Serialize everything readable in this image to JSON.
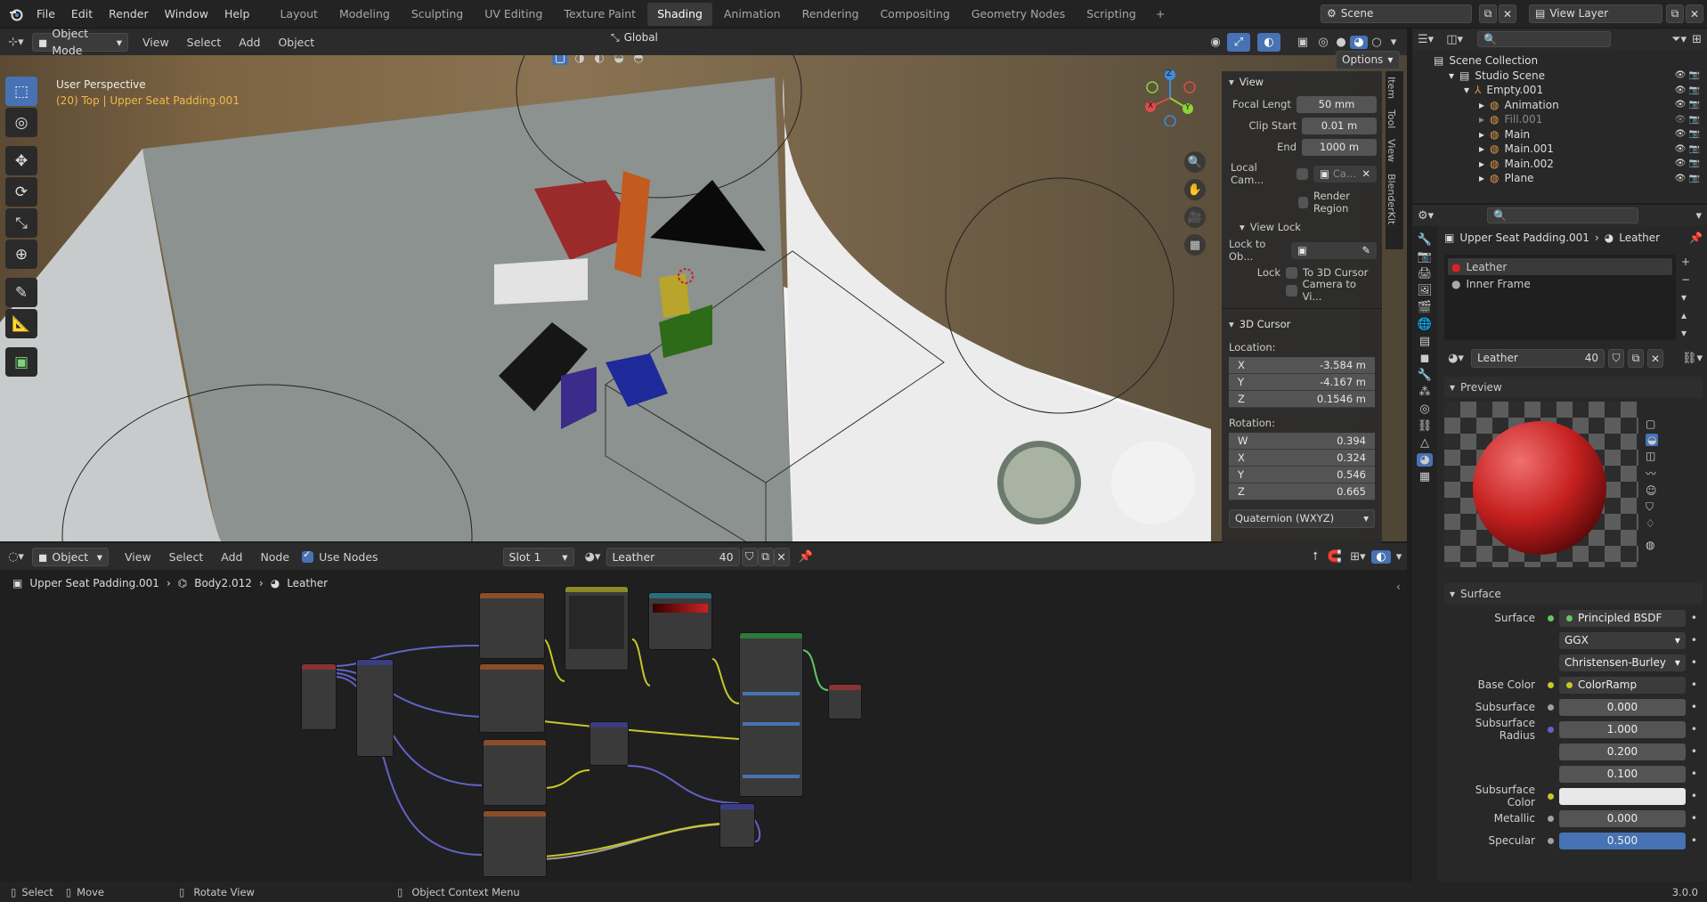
{
  "topbar": {
    "menus": [
      "File",
      "Edit",
      "Render",
      "Window",
      "Help"
    ],
    "workspaces": [
      "Layout",
      "Modeling",
      "Sculpting",
      "UV Editing",
      "Texture Paint",
      "Shading",
      "Animation",
      "Rendering",
      "Compositing",
      "Geometry Nodes",
      "Scripting"
    ],
    "active_workspace": "Shading",
    "add_tab": "+",
    "scene": "Scene",
    "view_layer": "View Layer"
  },
  "viewport": {
    "mode": "Object Mode",
    "menus": [
      "View",
      "Select",
      "Add",
      "Object"
    ],
    "orientation": "Global",
    "options": "Options",
    "overlay_title": "User Perspective",
    "overlay_sub": "(20) Top | Upper Seat Padding.001",
    "gizmo": {
      "z": "Z",
      "x": "X",
      "y": "Y"
    }
  },
  "npanel": {
    "tabs": [
      "Item",
      "Tool",
      "View",
      "BlenderKit"
    ],
    "view": {
      "header": "View",
      "focal_label": "Focal Lengt",
      "focal": "50 mm",
      "clip_start_label": "Clip Start",
      "clip_start": "0.01 m",
      "end_label": "End",
      "end": "1000 m",
      "local_cam_label": "Local Cam...",
      "local_cam_value": "Ca...",
      "render_region": "Render Region",
      "view_lock": "View Lock",
      "lock_to_obj_label": "Lock to Ob...",
      "lock_label": "Lock",
      "lock_cursor": "To 3D Cursor",
      "lock_camera": "Camera to Vi..."
    },
    "cursor": {
      "header": "3D Cursor",
      "location": "Location:",
      "loc": [
        {
          "k": "X",
          "v": "-3.584 m"
        },
        {
          "k": "Y",
          "v": "-4.167 m"
        },
        {
          "k": "Z",
          "v": "0.1546 m"
        }
      ],
      "rotation": "Rotation:",
      "rot": [
        {
          "k": "W",
          "v": "0.394"
        },
        {
          "k": "X",
          "v": "0.324"
        },
        {
          "k": "Y",
          "v": "0.546"
        },
        {
          "k": "Z",
          "v": "0.665"
        }
      ],
      "mode": "Quaternion (WXYZ)"
    }
  },
  "outliner": {
    "root": "Scene Collection",
    "items": [
      {
        "name": "Studio Scene",
        "indent": 1
      },
      {
        "name": "Empty.001",
        "indent": 2
      },
      {
        "name": "Animation",
        "indent": 3
      },
      {
        "name": "Fill.001",
        "indent": 3,
        "dim": true
      },
      {
        "name": "Main",
        "indent": 3
      },
      {
        "name": "Main.001",
        "indent": 3
      },
      {
        "name": "Main.002",
        "indent": 3
      },
      {
        "name": "Plane",
        "indent": 3
      }
    ]
  },
  "properties": {
    "breadcrumb_obj": "Upper Seat Padding.001",
    "breadcrumb_mat": "Leather",
    "slots": [
      "Leather",
      "Inner Frame"
    ],
    "material": "Leather",
    "users": "40",
    "preview": "Preview",
    "surface_header": "Surface",
    "rows": [
      {
        "l": "Surface",
        "v": "Principled BSDF",
        "kind": "link",
        "dot": "#63c763"
      },
      {
        "l": "",
        "v": "GGX",
        "kind": "dd"
      },
      {
        "l": "",
        "v": "Christensen-Burley",
        "kind": "dd"
      },
      {
        "l": "Base Color",
        "v": "ColorRamp",
        "kind": "link",
        "dot": "#c7c729"
      },
      {
        "l": "Subsurface",
        "v": "0.000",
        "kind": "num",
        "dot": "#a1a1a1"
      },
      {
        "l": "Subsurface Radius",
        "v": "1.000",
        "kind": "num",
        "dot": "#6363c7"
      },
      {
        "l": "",
        "v": "0.200",
        "kind": "num"
      },
      {
        "l": "",
        "v": "0.100",
        "kind": "num"
      },
      {
        "l": "Subsurface Color",
        "v": "",
        "kind": "color",
        "dot": "#c7c729"
      },
      {
        "l": "Metallic",
        "v": "0.000",
        "kind": "num",
        "dot": "#a1a1a1"
      },
      {
        "l": "Specular",
        "v": "0.500",
        "kind": "bar",
        "dot": "#a1a1a1"
      }
    ]
  },
  "shader": {
    "object": "Object",
    "menus": [
      "View",
      "Select",
      "Add",
      "Node"
    ],
    "use_nodes": "Use Nodes",
    "slot": "Slot 1",
    "material": "Leather",
    "users": "40",
    "breadcrumb": [
      "Upper Seat Padding.001",
      "Body2.012",
      "Leather"
    ]
  },
  "status": {
    "select": "Select",
    "move": "Move",
    "rotate": "Rotate View",
    "context": "Object Context Menu",
    "version": "3.0.0"
  },
  "colors": {
    "accent": "#4772b3",
    "header": "#2b2b2b",
    "topbar": "#232323"
  }
}
